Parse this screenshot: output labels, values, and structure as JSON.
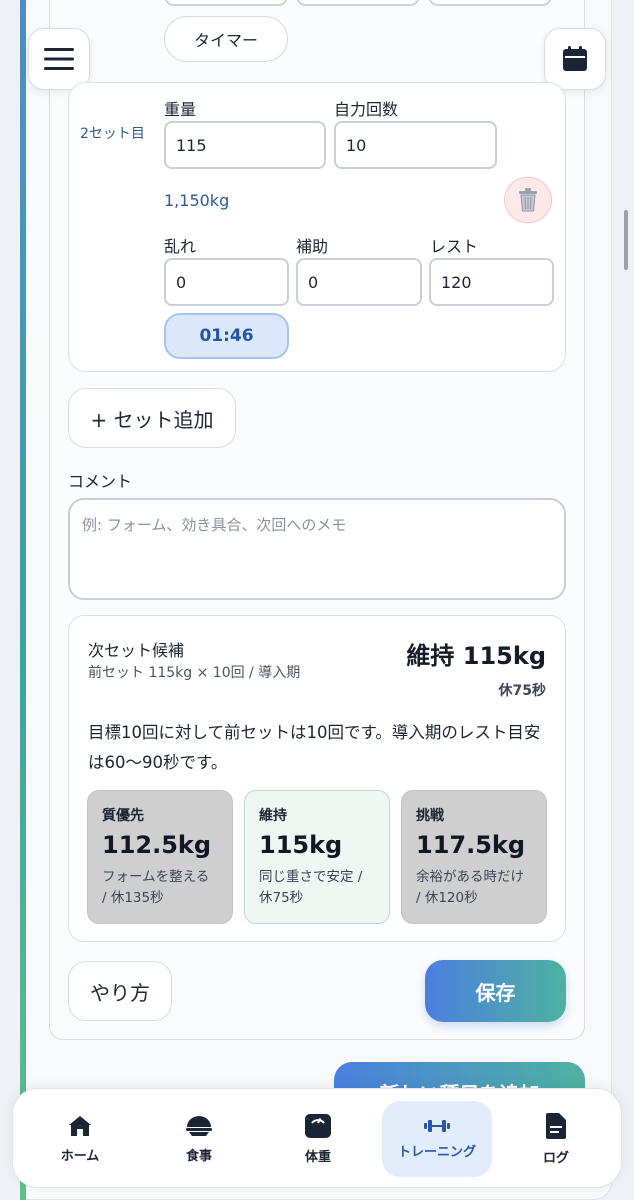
{
  "top": {
    "timer_button": "タイマー"
  },
  "set2": {
    "label": "2セット目",
    "weight_label": "重量",
    "weight_value": "115",
    "reps_label": "自力回数",
    "reps_value": "10",
    "volume": "1,150kg",
    "disorder_label": "乱れ",
    "disorder_value": "0",
    "assist_label": "補助",
    "assist_value": "0",
    "rest_label": "レスト",
    "rest_value": "120",
    "rest_timer": "01:46"
  },
  "add_set_button": "+ セット追加",
  "comment": {
    "label": "コメント",
    "placeholder": "例: フォーム、効き具合、次回へのメモ"
  },
  "next_set": {
    "title": "次セット候補",
    "subtitle": "前セット 115kg × 10回 / 導入期",
    "recommendation": "維持 115kg",
    "rest": "休75秒",
    "description": "目標10回に対して前セットは10回です。導入期のレスト目安は60〜90秒です。",
    "options": [
      {
        "name": "質優先",
        "value": "112.5kg",
        "note": "フォームを整える / 休135秒"
      },
      {
        "name": "維持",
        "value": "115kg",
        "note": "同じ重さで安定 / 休75秒"
      },
      {
        "name": "挑戦",
        "value": "117.5kg",
        "note": "余裕がある時だけ / 休120秒"
      }
    ]
  },
  "howto_button": "やり方",
  "save_button": "保存",
  "add_exercise_button": "新しい種目を追加",
  "tabs": [
    {
      "label": "ホーム",
      "icon": "home-icon"
    },
    {
      "label": "食事",
      "icon": "meal-icon"
    },
    {
      "label": "体重",
      "icon": "scale-icon"
    },
    {
      "label": "トレーニング",
      "icon": "dumbbell-icon"
    },
    {
      "label": "ログ",
      "icon": "document-icon"
    }
  ],
  "active_tab": "トレーニング"
}
